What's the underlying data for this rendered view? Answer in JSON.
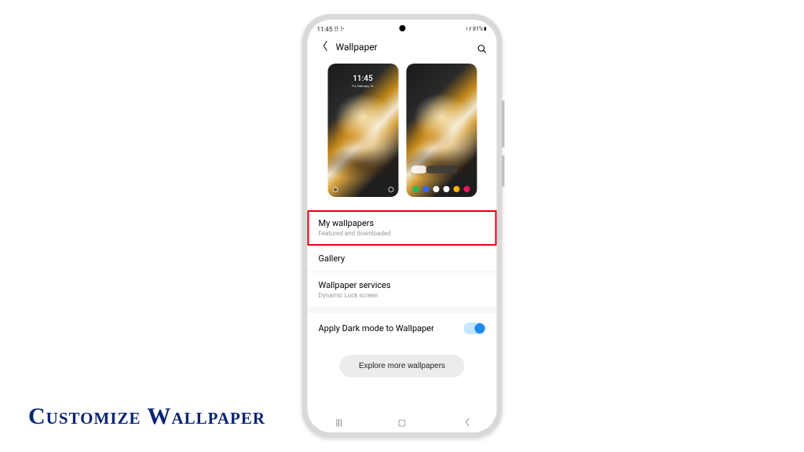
{
  "caption": "Customize Wallpaper",
  "status": {
    "time": "11:45",
    "extras": "⠿ ⠗",
    "right": "⟊ ⫽ 81%▮"
  },
  "header": {
    "title": "Wallpaper"
  },
  "previews": {
    "lock": {
      "time": "11:45",
      "date": "Fri, February 12"
    },
    "home": {}
  },
  "options": [
    {
      "label": "My wallpapers",
      "sub": "Featured and downloaded",
      "highlighted": true
    },
    {
      "label": "Gallery",
      "sub": ""
    },
    {
      "label": "Wallpaper services",
      "sub": "Dynamic Lock screen"
    }
  ],
  "dark_mode": {
    "label": "Apply Dark mode to Wallpaper",
    "on": true
  },
  "explore": {
    "label": "Explore more wallpapers"
  },
  "nav": {
    "recent": "|||",
    "home": "▢",
    "back": "〈"
  }
}
